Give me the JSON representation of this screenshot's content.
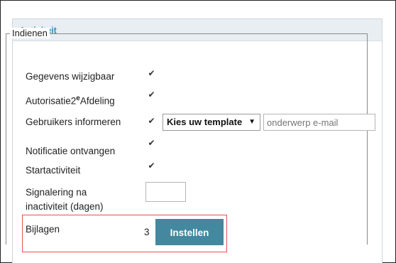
{
  "panel": {
    "title": "Activiteit"
  },
  "fieldset": {
    "legend": "Indienen"
  },
  "rows": {
    "gegevens": {
      "label": "Gegevens wijzigbaar",
      "checked": true
    },
    "autorisatie": {
      "label": "Autorisatie2",
      "sup": "e",
      "label_rest": "Afdeling",
      "checked": true
    },
    "gebruikers": {
      "label": "Gebruikers informeren",
      "checked": true
    },
    "notificatie": {
      "label": "Notificatie ontvangen",
      "checked": true
    },
    "startactiviteit": {
      "label": "Startactiviteit",
      "checked": true
    },
    "signalering": {
      "label_line1": "Signalering na",
      "label_line2": "inactiviteit (dagen)",
      "value": ""
    },
    "bijlagen": {
      "label": "Bijlagen",
      "count": "3",
      "button_label": "Instellen"
    }
  },
  "template_select": {
    "selected": "Kies uw template",
    "arrow": "▼"
  },
  "email_subject": {
    "placeholder": "onderwerp e-mail",
    "value": ""
  },
  "check_glyph": "✔",
  "colors": {
    "accent": "#43889f",
    "title": "#3a8da8",
    "highlight": "#e0534f",
    "header_bg": "#e8eef1"
  }
}
